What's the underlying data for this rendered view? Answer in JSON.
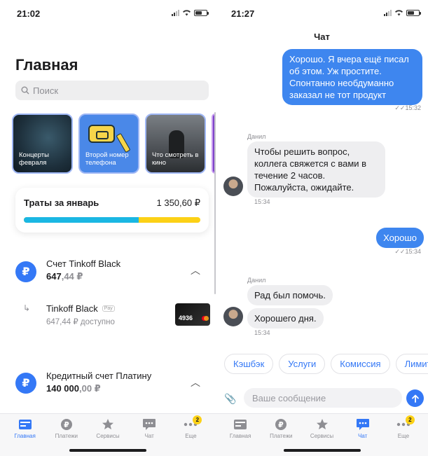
{
  "left": {
    "status": {
      "time": "21:02"
    },
    "title": "Главная",
    "search": {
      "placeholder": "Поиск"
    },
    "stories": [
      {
        "label": "Концерты февраля"
      },
      {
        "label": "Второй номер телефона"
      },
      {
        "label": "Что смотреть в кино"
      }
    ],
    "spending": {
      "title": "Траты за январь",
      "amount": "1 350,60 ₽",
      "split_fraction": 0.65
    },
    "account1": {
      "name": "Счет Tinkoff Black",
      "amount_main": "647",
      "amount_cents": ",44 ₽"
    },
    "subcard": {
      "name": "Tinkoff Black",
      "pay_badge": "Pay",
      "available": "647,44 ₽ доступно",
      "card_number": "4936"
    },
    "account2": {
      "name": "Кредитный счет Платину",
      "amount_main": "140 000",
      "amount_cents": ",00 ₽"
    },
    "rub_symbol": "₽"
  },
  "right": {
    "status": {
      "time": "21:27"
    },
    "title": "Чат",
    "messages": [
      {
        "text": "Хорошо. Я вчера ещё писал об этом. Уж простите. Спонтанно необдуманно заказал не тот продукт",
        "time": "✓✓15:32"
      },
      {
        "sender": "Данил",
        "text": "Чтобы решить вопрос, коллега свяжется с вами в течение 2 часов. Пожалуйста, ожидайте.",
        "time": "15:34"
      },
      {
        "text": "Хорошо",
        "time": "✓✓15:34"
      },
      {
        "sender": "Данил",
        "text": "Рад был помочь.",
        "text2": "Хорошего дня.",
        "time": "15:34"
      }
    ],
    "quick_replies": [
      "Кэшбэк",
      "Услуги",
      "Комиссия",
      "Лимит"
    ],
    "input": {
      "placeholder": "Ваше сообщение"
    }
  },
  "tabs": [
    {
      "label": "Главная"
    },
    {
      "label": "Платежи"
    },
    {
      "label": "Сервисы"
    },
    {
      "label": "Чат"
    },
    {
      "label": "Еще",
      "badge": "2"
    }
  ],
  "colors": {
    "accent": "#3478f6",
    "bubble_out": "#3e86ef",
    "bar_blue": "#1ab7e3",
    "bar_yellow": "#fcd116"
  }
}
